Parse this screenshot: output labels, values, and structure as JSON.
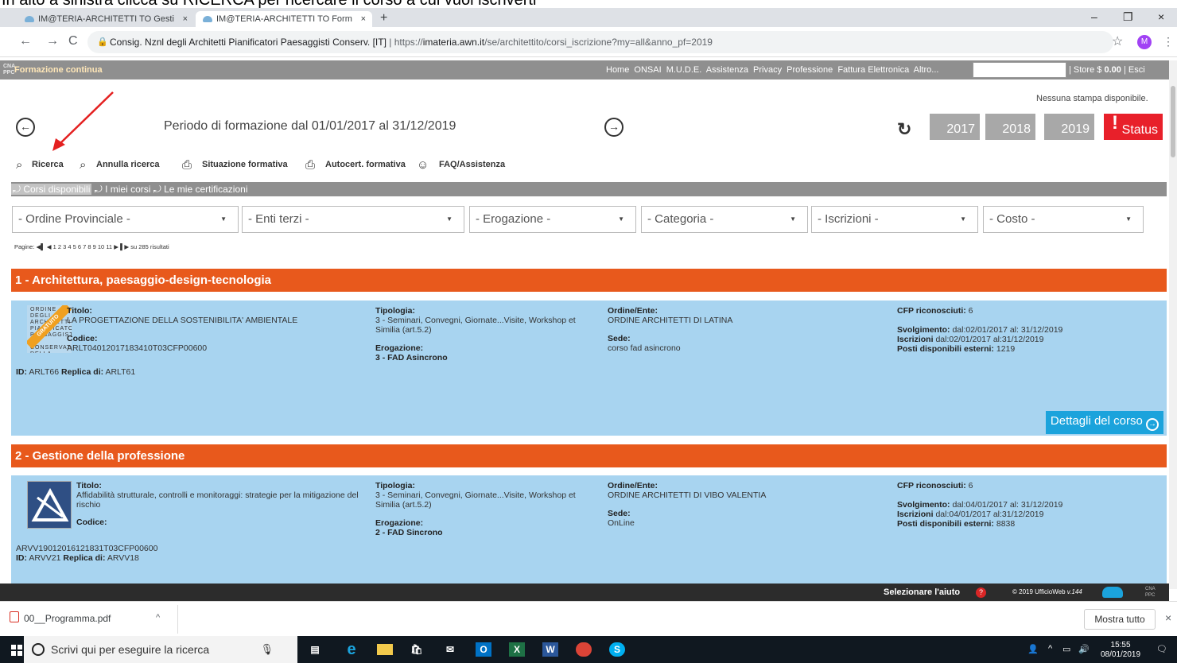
{
  "caption": "In alto a sinistra clicca su RICERCA per ricercare il corso a cui vuoi iscriverti",
  "browser": {
    "tabs": [
      {
        "label": "IM@TERIA-ARCHITETTI TO Gesti"
      },
      {
        "label": "IM@TERIA-ARCHITETTI TO Form"
      }
    ],
    "tab_close": "×",
    "new_tab": "+",
    "min": "–",
    "max": "❐",
    "close": "×",
    "back": "←",
    "forward": "→",
    "reload": "C",
    "site_identity": "Consig. Nznl degli Architetti Pianificatori Paesaggisti Conserv. [IT]",
    "url_prefix": "https://",
    "url_host": "imateria.awn.it",
    "url_path": "/se/architettito/corsi_iscrizione?my=all&anno_pf=2019",
    "profile_initial": "M",
    "star": "☆",
    "kebab": "⋮"
  },
  "app": {
    "brand": "Formazione continua",
    "logo_text": "CNA PPC",
    "top_menu": [
      "Home",
      "ONSAI",
      "M.U.D.E.",
      "Assistenza",
      "Privacy",
      "Professione",
      "Fattura Elettronica",
      "Altro..."
    ],
    "store": "| Store $",
    "store_amount": "0.00",
    "esci": "| Esci"
  },
  "periodo": {
    "nessuna_stampa": "Nessuna stampa disponibile.",
    "text": "Periodo di formazione dal 01/01/2017 al 31/12/2019",
    "prev_icon": "←",
    "next_icon": "→",
    "refresh_icon": "↻",
    "years": [
      "2017",
      "2018",
      "2019"
    ],
    "status": "Status",
    "status_mark": "!"
  },
  "toolbar": {
    "ricerca": "Ricerca",
    "annulla": "Annulla ricerca",
    "situazione": "Situazione formativa",
    "autocert": "Autocert. formativa",
    "faq": "FAQ/Assistenza"
  },
  "subtabs": [
    "Corsi disponibili",
    "I miei corsi",
    "Le mie certificazioni"
  ],
  "subtab_icon": "⤾",
  "filters": [
    "- Ordine Provinciale -",
    "- Enti terzi -",
    "- Erogazione -",
    "- Categoria -",
    "- Iscrizioni -",
    "- Costo -"
  ],
  "filter_caret": "▼",
  "pager": {
    "prefix": "Pagine:",
    "first": "◀▌",
    "prev": "◀",
    "pages": "1 2 3 4 5 6 7 8 9 10 11",
    "next": "▶",
    "last": "▌▶",
    "suffix": "su 285 risultati"
  },
  "courses": [
    {
      "category": "1 - Architettura, paesaggio-design-tecnologia",
      "labels": {
        "titolo": "Titolo:",
        "codice": "Codice:",
        "id": "ID:",
        "replica": "Replica di:",
        "tipologia": "Tipologia:",
        "erogazione": "Erogazione:",
        "ordine": "Ordine/Ente:",
        "sede": "Sede:",
        "cfp": "CFP riconosciuti:",
        "svolgimento": "Svolgimento:",
        "iscrizioni": "Iscrizioni",
        "posti": "Posti disponibili esterni:"
      },
      "titolo": "LA PROGETTAZIONE DELLA SOSTENIBILITA' AMBIENTALE",
      "codice": "ARLT04012017183410T03CFP00600",
      "id": "ARLT66",
      "replica": "ARLT61",
      "tipologia": "3 - Seminari, Convegni, Giornate...Visite, Workshop et Similia (art.5.2)",
      "erogazione": "3 - FAD Asincrono",
      "ordine": "ORDINE ARCHITETTI DI LATINA",
      "sede": "corso fad asincrono",
      "cfp": "6",
      "svolgimento": "dal:02/01/2017 al: 31/12/2019",
      "iscrizioni": "dal:02/01/2017 al:31/12/2019",
      "posti": "1219",
      "badge": "GRATUITO",
      "thumb_text": "ORDINE DEGLI ARCHITETTI PIANIFICATORI PAESAGGISTI E CONSERVATORI DELLA PROVINCIA DI LATINA",
      "dettagli": "Dettagli del corso"
    },
    {
      "category": "2 - Gestione della professione",
      "labels": {
        "titolo": "Titolo:",
        "codice": "Codice:",
        "id": "ID:",
        "replica": "Replica di:",
        "tipologia": "Tipologia:",
        "erogazione": "Erogazione:",
        "ordine": "Ordine/Ente:",
        "sede": "Sede:",
        "cfp": "CFP riconosciuti:",
        "svolgimento": "Svolgimento:",
        "iscrizioni": "Iscrizioni",
        "posti": "Posti disponibili esterni:"
      },
      "titolo": "Affidabilità strutturale, controlli e monitoraggi: strategie per la mitigazione del rischio",
      "codice": "ARVV19012016121831T03CFP00600",
      "id": "ARVV21",
      "replica": "ARVV18",
      "tipologia": "3 - Seminari, Convegni, Giornate...Visite, Workshop et Similia (art.5.2)",
      "erogazione": "2 - FAD Sincrono",
      "ordine": "ORDINE ARCHITETTI DI VIBO VALENTIA",
      "sede": "OnLine",
      "cfp": "6",
      "svolgimento": "dal:04/01/2017 al: 31/12/2019",
      "iscrizioni": "dal:04/01/2017 al:31/12/2019",
      "posti": "8838"
    }
  ],
  "footer": {
    "aiuto": "Selezionare l'aiuto",
    "aiuto_q": "?",
    "copyright": "© 2019 UfficioWeb",
    "version": "v.144",
    "logo_text": "CNA PPC"
  },
  "download": {
    "file": "00__Programma.pdf",
    "caret": "^",
    "mostra": "Mostra tutto",
    "close": "×"
  },
  "taskbar": {
    "search_placeholder": "Scrivi qui per eseguire la ricerca",
    "time": "15:55",
    "date": "08/01/2019"
  },
  "colors": {
    "category_bar": "#e8591c",
    "card_bg": "#a8d4f0",
    "status_red": "#e8202a",
    "dettagli_blue": "#1ba3dc"
  }
}
